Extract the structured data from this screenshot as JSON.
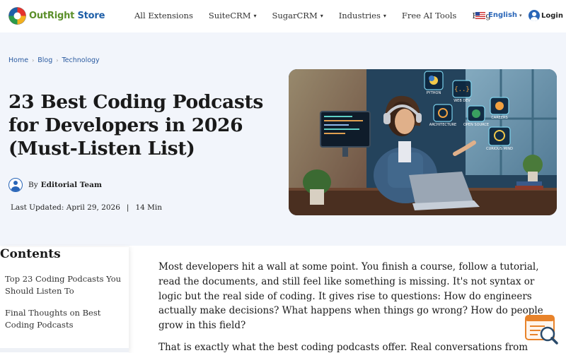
{
  "header": {
    "logo_part1": "OutRight",
    "logo_part2": "Store",
    "nav": [
      {
        "label": "All Extensions"
      },
      {
        "label": "SuiteCRM",
        "caret": "▾"
      },
      {
        "label": "SugarCRM",
        "caret": "▾"
      },
      {
        "label": "Industries",
        "caret": "▾"
      },
      {
        "label": "Free AI Tools"
      },
      {
        "label": "Blog"
      }
    ],
    "language": "English",
    "language_caret": "▾",
    "login": "Login"
  },
  "breadcrumb": {
    "items": [
      "Home",
      "Blog",
      "Technology"
    ],
    "separator": "›"
  },
  "article_header": {
    "title": "23 Best Coding Podcasts for Developers in 2026 (Must-Listen List)",
    "by_label": "By",
    "author": "Editorial Team",
    "updated": "Last Updated: April 29, 2026",
    "divider": "|",
    "read_time": "14 Min"
  },
  "hero_image": {
    "labels": [
      "PYTHON",
      "WEB DEV",
      "ARCHITECTURE",
      "OPEN SOURCE",
      "CAREERS",
      "CURIOUS MIND"
    ]
  },
  "toc": {
    "title": "Contents",
    "items": [
      "Top 23 Coding Podcasts You Should Listen To",
      "Final Thoughts on Best Coding Podcasts"
    ]
  },
  "article": {
    "paragraphs": [
      "Most developers hit a wall at some point. You finish a course, follow a tutorial, read the documents, and still feel like something is missing. It's not syntax or logic but the real side of coding. It gives rise to questions: How do engineers actually make decisions? What happens when things go wrong? How do people grow in this field?",
      "That is exactly what the best coding podcasts offer. Real conversations from"
    ]
  },
  "colors": {
    "brand_green": "#5b8f2a",
    "brand_blue": "#1e5fa8",
    "link_blue": "#2a5aa0",
    "hero_bg": "#f2f5fb",
    "widget_orange": "#e8832a"
  }
}
